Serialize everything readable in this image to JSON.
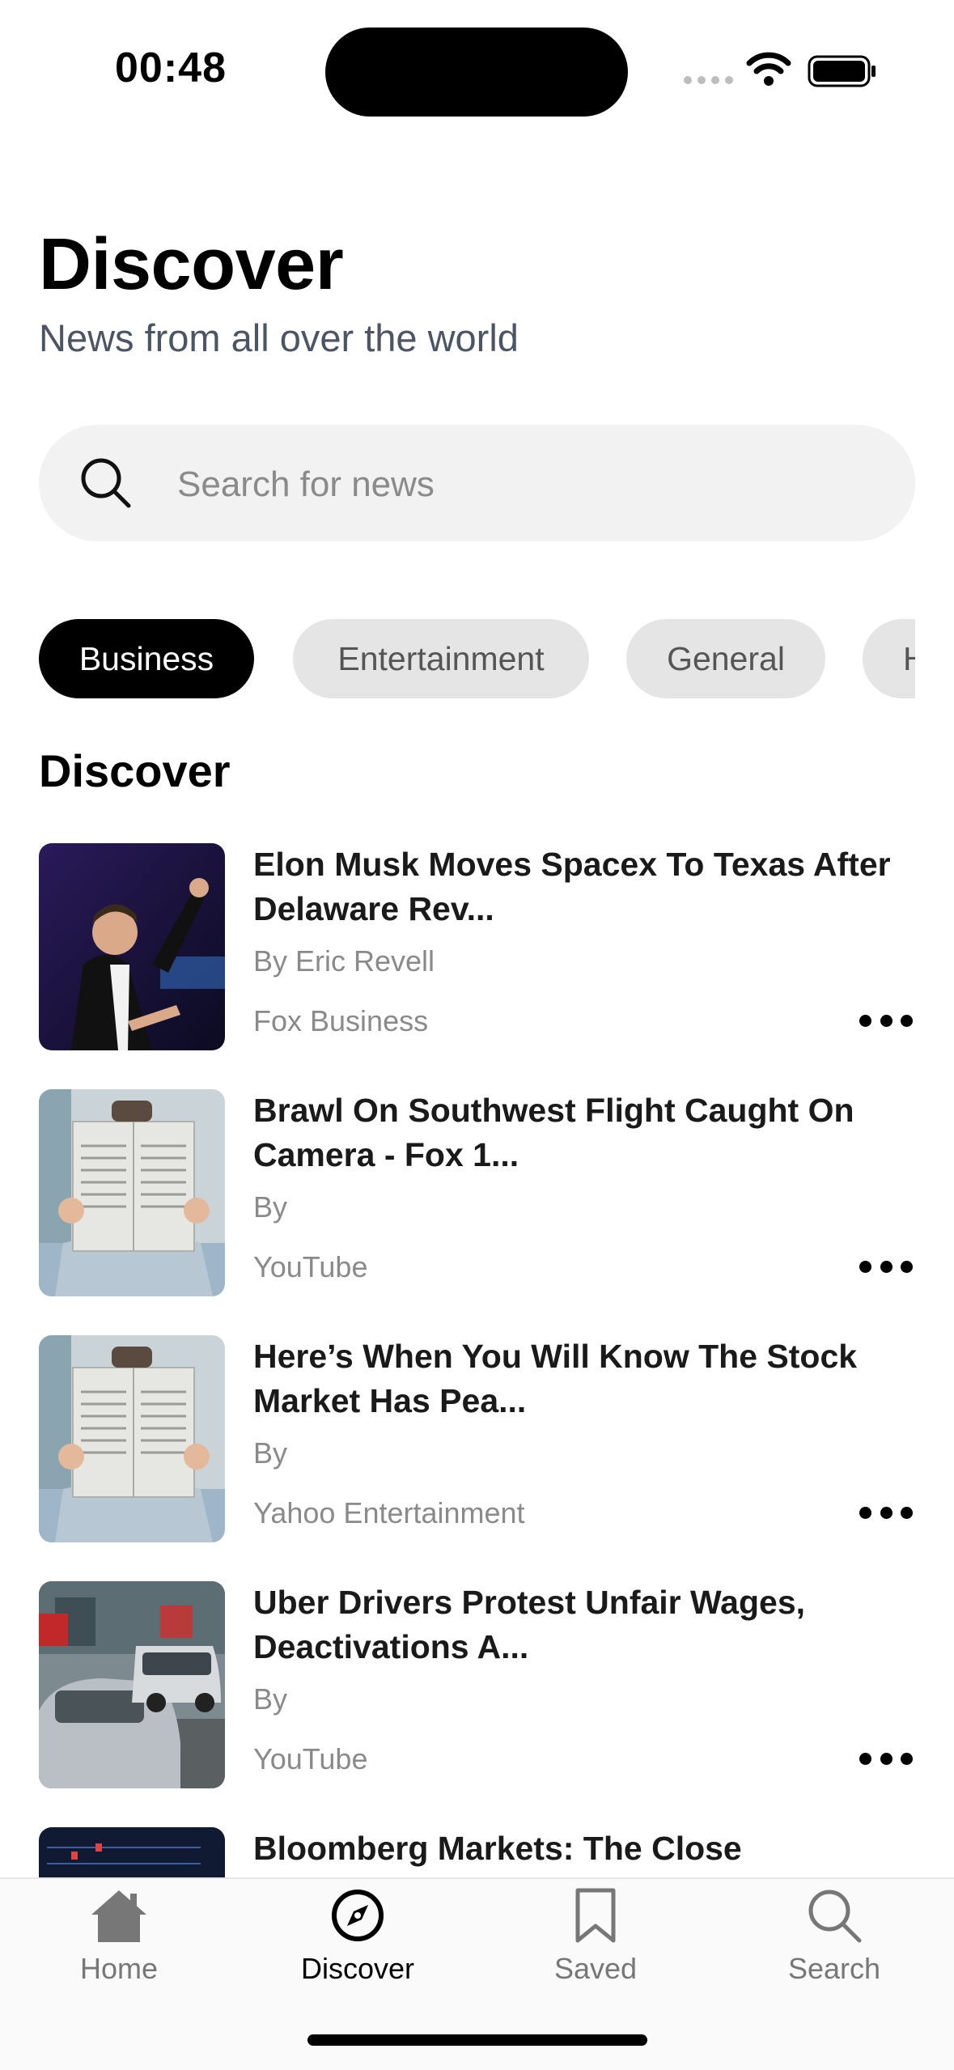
{
  "status_bar": {
    "time": "00:48"
  },
  "header": {
    "title": "Discover",
    "subtitle": "News from all over the world"
  },
  "search": {
    "placeholder": "Search for news",
    "value": ""
  },
  "categories": [
    {
      "label": "Business",
      "active": true
    },
    {
      "label": "Entertainment",
      "active": false
    },
    {
      "label": "General",
      "active": false
    },
    {
      "label": "H",
      "active": false
    }
  ],
  "section_title": "Discover",
  "articles": [
    {
      "title": "Elon Musk Moves Spacex To Texas After Delaware Rev...",
      "author": "By Eric Revell",
      "source": "Fox Business",
      "thumbnail": "person-photo"
    },
    {
      "title": "Brawl On Southwest Flight Caught On Camera - Fox 1...",
      "author": "By",
      "source": "YouTube",
      "thumbnail": "newspaper-photo"
    },
    {
      "title": "Here’s When You Will Know The Stock Market Has Pea...",
      "author": "By",
      "source": "Yahoo Entertainment",
      "thumbnail": "newspaper-photo"
    },
    {
      "title": "Uber Drivers Protest Unfair Wages, Deactivations A...",
      "author": "By",
      "source": "YouTube",
      "thumbnail": "street-cars-photo"
    },
    {
      "title": "Bloomberg Markets: The Close",
      "author": "",
      "source": "",
      "thumbnail": "market-screen-photo"
    }
  ],
  "tab_bar": [
    {
      "label": "Home",
      "icon": "house-icon",
      "active": false
    },
    {
      "label": "Discover",
      "icon": "compass-icon",
      "active": true
    },
    {
      "label": "Saved",
      "icon": "bookmark-icon",
      "active": false
    },
    {
      "label": "Search",
      "icon": "magnifier-icon",
      "active": false
    }
  ],
  "colors": {
    "accent": "#000000",
    "chip_inactive": "#e5e5e5",
    "search_bg": "#f2f2f2",
    "muted_text": "#8a8a8a"
  }
}
